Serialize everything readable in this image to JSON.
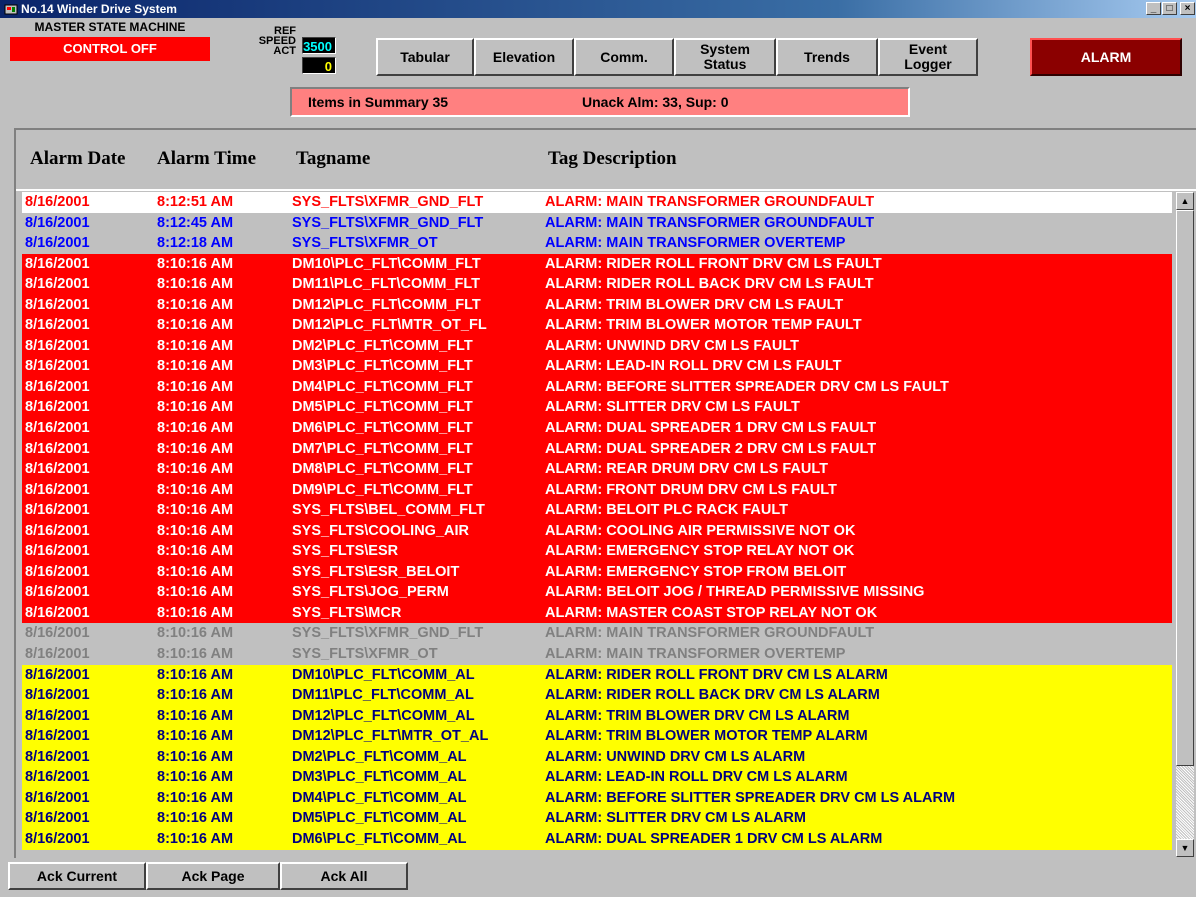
{
  "window": {
    "title": "No.14 Winder Drive System",
    "controls": [
      "_",
      "□",
      "×"
    ]
  },
  "state_machine": {
    "label": "MASTER STATE MACHINE",
    "status": "CONTROL OFF"
  },
  "speed": {
    "ref_label": "REF",
    "speed_label": "SPEED",
    "act_label": "ACT",
    "ref_value": "3500",
    "act_value": "0",
    "ref_color": "#00ffff",
    "act_color": "#ffff00"
  },
  "nav": {
    "tabular": "Tabular",
    "elevation": "Elevation",
    "comm": "Comm.",
    "system_status": "System\nStatus",
    "trends": "Trends",
    "event_logger": "Event\nLogger"
  },
  "alarm_button": "ALARM",
  "summary": {
    "items": "Items in Summary  35",
    "unack": "Unack Alm:  33, Sup:   0"
  },
  "columns": {
    "date": "Alarm Date",
    "time": "Alarm Time",
    "tag": "Tagname",
    "desc": "Tag Description"
  },
  "colors": {
    "unack_red": "#ff0000",
    "active_blue": "#0000ff",
    "alarm_bg": "#ff0000",
    "warning_bg": "#ffff00",
    "acked_gray": "#808080"
  },
  "rows": [
    {
      "state": "white",
      "date": "8/16/2001",
      "time": "8:12:51 AM",
      "tag": "SYS_FLTS\\XFMR_GND_FLT",
      "desc": "ALARM: MAIN TRANSFORMER GROUNDFAULT"
    },
    {
      "state": "gray",
      "date": "8/16/2001",
      "time": "8:12:45 AM",
      "tag": "SYS_FLTS\\XFMR_GND_FLT",
      "desc": "ALARM: MAIN TRANSFORMER GROUNDFAULT"
    },
    {
      "state": "gray",
      "date": "8/16/2001",
      "time": "8:12:18 AM",
      "tag": "SYS_FLTS\\XFMR_OT",
      "desc": "ALARM: MAIN TRANSFORMER OVERTEMP"
    },
    {
      "state": "red",
      "date": "8/16/2001",
      "time": "8:10:16 AM",
      "tag": "DM10\\PLC_FLT\\COMM_FLT",
      "desc": "ALARM: RIDER ROLL FRONT DRV CM LS FAULT"
    },
    {
      "state": "red",
      "date": "8/16/2001",
      "time": "8:10:16 AM",
      "tag": "DM11\\PLC_FLT\\COMM_FLT",
      "desc": "ALARM: RIDER ROLL BACK DRV CM LS FAULT"
    },
    {
      "state": "red",
      "date": "8/16/2001",
      "time": "8:10:16 AM",
      "tag": "DM12\\PLC_FLT\\COMM_FLT",
      "desc": "ALARM: TRIM BLOWER DRV CM LS FAULT"
    },
    {
      "state": "red",
      "date": "8/16/2001",
      "time": "8:10:16 AM",
      "tag": "DM12\\PLC_FLT\\MTR_OT_FL",
      "desc": "ALARM: TRIM BLOWER MOTOR TEMP FAULT"
    },
    {
      "state": "red",
      "date": "8/16/2001",
      "time": "8:10:16 AM",
      "tag": "DM2\\PLC_FLT\\COMM_FLT",
      "desc": "ALARM: UNWIND DRV CM LS FAULT"
    },
    {
      "state": "red",
      "date": "8/16/2001",
      "time": "8:10:16 AM",
      "tag": "DM3\\PLC_FLT\\COMM_FLT",
      "desc": "ALARM: LEAD-IN ROLL DRV CM LS FAULT"
    },
    {
      "state": "red",
      "date": "8/16/2001",
      "time": "8:10:16 AM",
      "tag": "DM4\\PLC_FLT\\COMM_FLT",
      "desc": "ALARM: BEFORE SLITTER SPREADER  DRV CM LS FAULT"
    },
    {
      "state": "red",
      "date": "8/16/2001",
      "time": "8:10:16 AM",
      "tag": "DM5\\PLC_FLT\\COMM_FLT",
      "desc": "ALARM: SLITTER DRV CM LS FAULT"
    },
    {
      "state": "red",
      "date": "8/16/2001",
      "time": "8:10:16 AM",
      "tag": "DM6\\PLC_FLT\\COMM_FLT",
      "desc": "ALARM: DUAL SPREADER 1 DRV CM LS FAULT"
    },
    {
      "state": "red",
      "date": "8/16/2001",
      "time": "8:10:16 AM",
      "tag": "DM7\\PLC_FLT\\COMM_FLT",
      "desc": "ALARM: DUAL SPREADER 2 DRV CM LS FAULT"
    },
    {
      "state": "red",
      "date": "8/16/2001",
      "time": "8:10:16 AM",
      "tag": "DM8\\PLC_FLT\\COMM_FLT",
      "desc": "ALARM: REAR DRUM DRV CM LS FAULT"
    },
    {
      "state": "red",
      "date": "8/16/2001",
      "time": "8:10:16 AM",
      "tag": "DM9\\PLC_FLT\\COMM_FLT",
      "desc": "ALARM: FRONT DRUM DRV CM LS FAULT"
    },
    {
      "state": "red",
      "date": "8/16/2001",
      "time": "8:10:16 AM",
      "tag": "SYS_FLTS\\BEL_COMM_FLT",
      "desc": "ALARM: BELOIT PLC RACK FAULT"
    },
    {
      "state": "red",
      "date": "8/16/2001",
      "time": "8:10:16 AM",
      "tag": "SYS_FLTS\\COOLING_AIR",
      "desc": "ALARM: COOLING AIR PERMISSIVE NOT OK"
    },
    {
      "state": "red",
      "date": "8/16/2001",
      "time": "8:10:16 AM",
      "tag": "SYS_FLTS\\ESR",
      "desc": "ALARM: EMERGENCY STOP RELAY NOT OK"
    },
    {
      "state": "red",
      "date": "8/16/2001",
      "time": "8:10:16 AM",
      "tag": "SYS_FLTS\\ESR_BELOIT",
      "desc": "ALARM: EMERGENCY STOP FROM BELOIT"
    },
    {
      "state": "red",
      "date": "8/16/2001",
      "time": "8:10:16 AM",
      "tag": "SYS_FLTS\\JOG_PERM",
      "desc": "ALARM: BELOIT JOG / THREAD PERMISSIVE MISSING"
    },
    {
      "state": "red",
      "date": "8/16/2001",
      "time": "8:10:16 AM",
      "tag": "SYS_FLTS\\MCR",
      "desc": "ALARM: MASTER COAST STOP RELAY NOT OK"
    },
    {
      "state": "grayck",
      "date": "8/16/2001",
      "time": "8:10:16 AM",
      "tag": "SYS_FLTS\\XFMR_GND_FLT",
      "desc": "ALARM: MAIN TRANSFORMER GROUNDFAULT"
    },
    {
      "state": "grayck",
      "date": "8/16/2001",
      "time": "8:10:16 AM",
      "tag": "SYS_FLTS\\XFMR_OT",
      "desc": "ALARM: MAIN TRANSFORMER OVERTEMP"
    },
    {
      "state": "yellow",
      "date": "8/16/2001",
      "time": "8:10:16 AM",
      "tag": "DM10\\PLC_FLT\\COMM_AL",
      "desc": "ALARM: RIDER ROLL FRONT DRV CM LS ALARM"
    },
    {
      "state": "yellow",
      "date": "8/16/2001",
      "time": "8:10:16 AM",
      "tag": "DM11\\PLC_FLT\\COMM_AL",
      "desc": "ALARM: RIDER ROLL BACK DRV CM LS ALARM"
    },
    {
      "state": "yellow",
      "date": "8/16/2001",
      "time": "8:10:16 AM",
      "tag": "DM12\\PLC_FLT\\COMM_AL",
      "desc": "ALARM: TRIM BLOWER DRV CM LS ALARM"
    },
    {
      "state": "yellow",
      "date": "8/16/2001",
      "time": "8:10:16 AM",
      "tag": "DM12\\PLC_FLT\\MTR_OT_AL",
      "desc": "ALARM: TRIM BLOWER MOTOR TEMP ALARM"
    },
    {
      "state": "yellow",
      "date": "8/16/2001",
      "time": "8:10:16 AM",
      "tag": "DM2\\PLC_FLT\\COMM_AL",
      "desc": "ALARM: UNWIND DRV CM LS ALARM"
    },
    {
      "state": "yellow",
      "date": "8/16/2001",
      "time": "8:10:16 AM",
      "tag": "DM3\\PLC_FLT\\COMM_AL",
      "desc": "ALARM: LEAD-IN ROLL DRV CM LS ALARM"
    },
    {
      "state": "yellow",
      "date": "8/16/2001",
      "time": "8:10:16 AM",
      "tag": "DM4\\PLC_FLT\\COMM_AL",
      "desc": "ALARM: BEFORE SLITTER SPREADER  DRV CM LS ALARM"
    },
    {
      "state": "yellow",
      "date": "8/16/2001",
      "time": "8:10:16 AM",
      "tag": "DM5\\PLC_FLT\\COMM_AL",
      "desc": "ALARM: SLITTER DRV CM LS ALARM"
    },
    {
      "state": "yellow",
      "date": "8/16/2001",
      "time": "8:10:16 AM",
      "tag": "DM6\\PLC_FLT\\COMM_AL",
      "desc": "ALARM: DUAL SPREADER 1 DRV CM LS ALARM"
    }
  ],
  "footer": {
    "ack_current": "Ack Current",
    "ack_page": "Ack Page",
    "ack_all": "Ack All"
  },
  "scrollbar": {
    "up": "▲",
    "down": "▼"
  }
}
